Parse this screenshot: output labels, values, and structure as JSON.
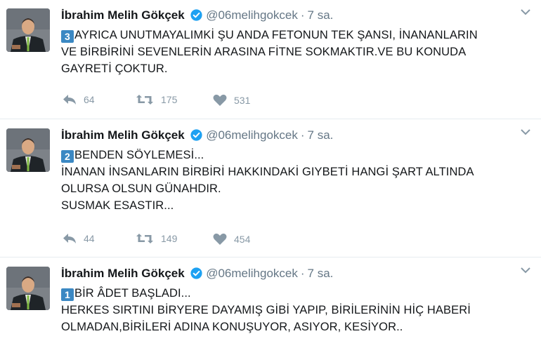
{
  "tweets": [
    {
      "name": "İbrahim Melih Gökçek",
      "handle": "@06melihgokcek",
      "separator": "·",
      "time": "7 sa.",
      "badge": "3",
      "lines": [
        "AYRICA UNUTMAYALIMKİ ŞU ANDA FETONUN TEK ŞANSI, İNANANLARIN",
        "VE BİRBİRİNİ SEVENLERİN ARASINA FİTNE SOKMAKTIR.VE BU KONUDA",
        "GAYRETİ ÇOKTUR."
      ],
      "replies": "64",
      "retweets": "175",
      "likes": "531"
    },
    {
      "name": "İbrahim Melih Gökçek",
      "handle": "@06melihgokcek",
      "separator": "·",
      "time": "7 sa.",
      "badge": "2",
      "lines": [
        "BENDEN SÖYLEMESİ...",
        "İNANAN İNSANLARIN BİRBİRİ HAKKINDAKİ GIYBETİ HANGİ ŞART ALTINDA",
        "OLURSA OLSUN GÜNAHDIR.",
        "SUSMAK ESASTIR..."
      ],
      "replies": "44",
      "retweets": "149",
      "likes": "454"
    },
    {
      "name": "İbrahim Melih Gökçek",
      "handle": "@06melihgokcek",
      "separator": "·",
      "time": "7 sa.",
      "badge": "1",
      "lines": [
        "BİR ÂDET BAŞLADI...",
        "HERKES SIRTINI BİRYERE DAYAMIŞ GİBİ YAPIP, BİRİLERİNİN HİÇ HABERİ",
        "OLMADAN,BİRİLERİ ADINA KONUŞUYOR, ASIYOR, KESİYOR.."
      ]
    }
  ],
  "icons": {
    "verified": "verified-badge-icon",
    "caret": "chevron-down-icon",
    "reply": "reply-icon",
    "retweet": "retweet-icon",
    "like": "heart-icon"
  },
  "colors": {
    "verified": "#1da1f2",
    "badge": "#3b88c3",
    "action": "#8899a6"
  }
}
